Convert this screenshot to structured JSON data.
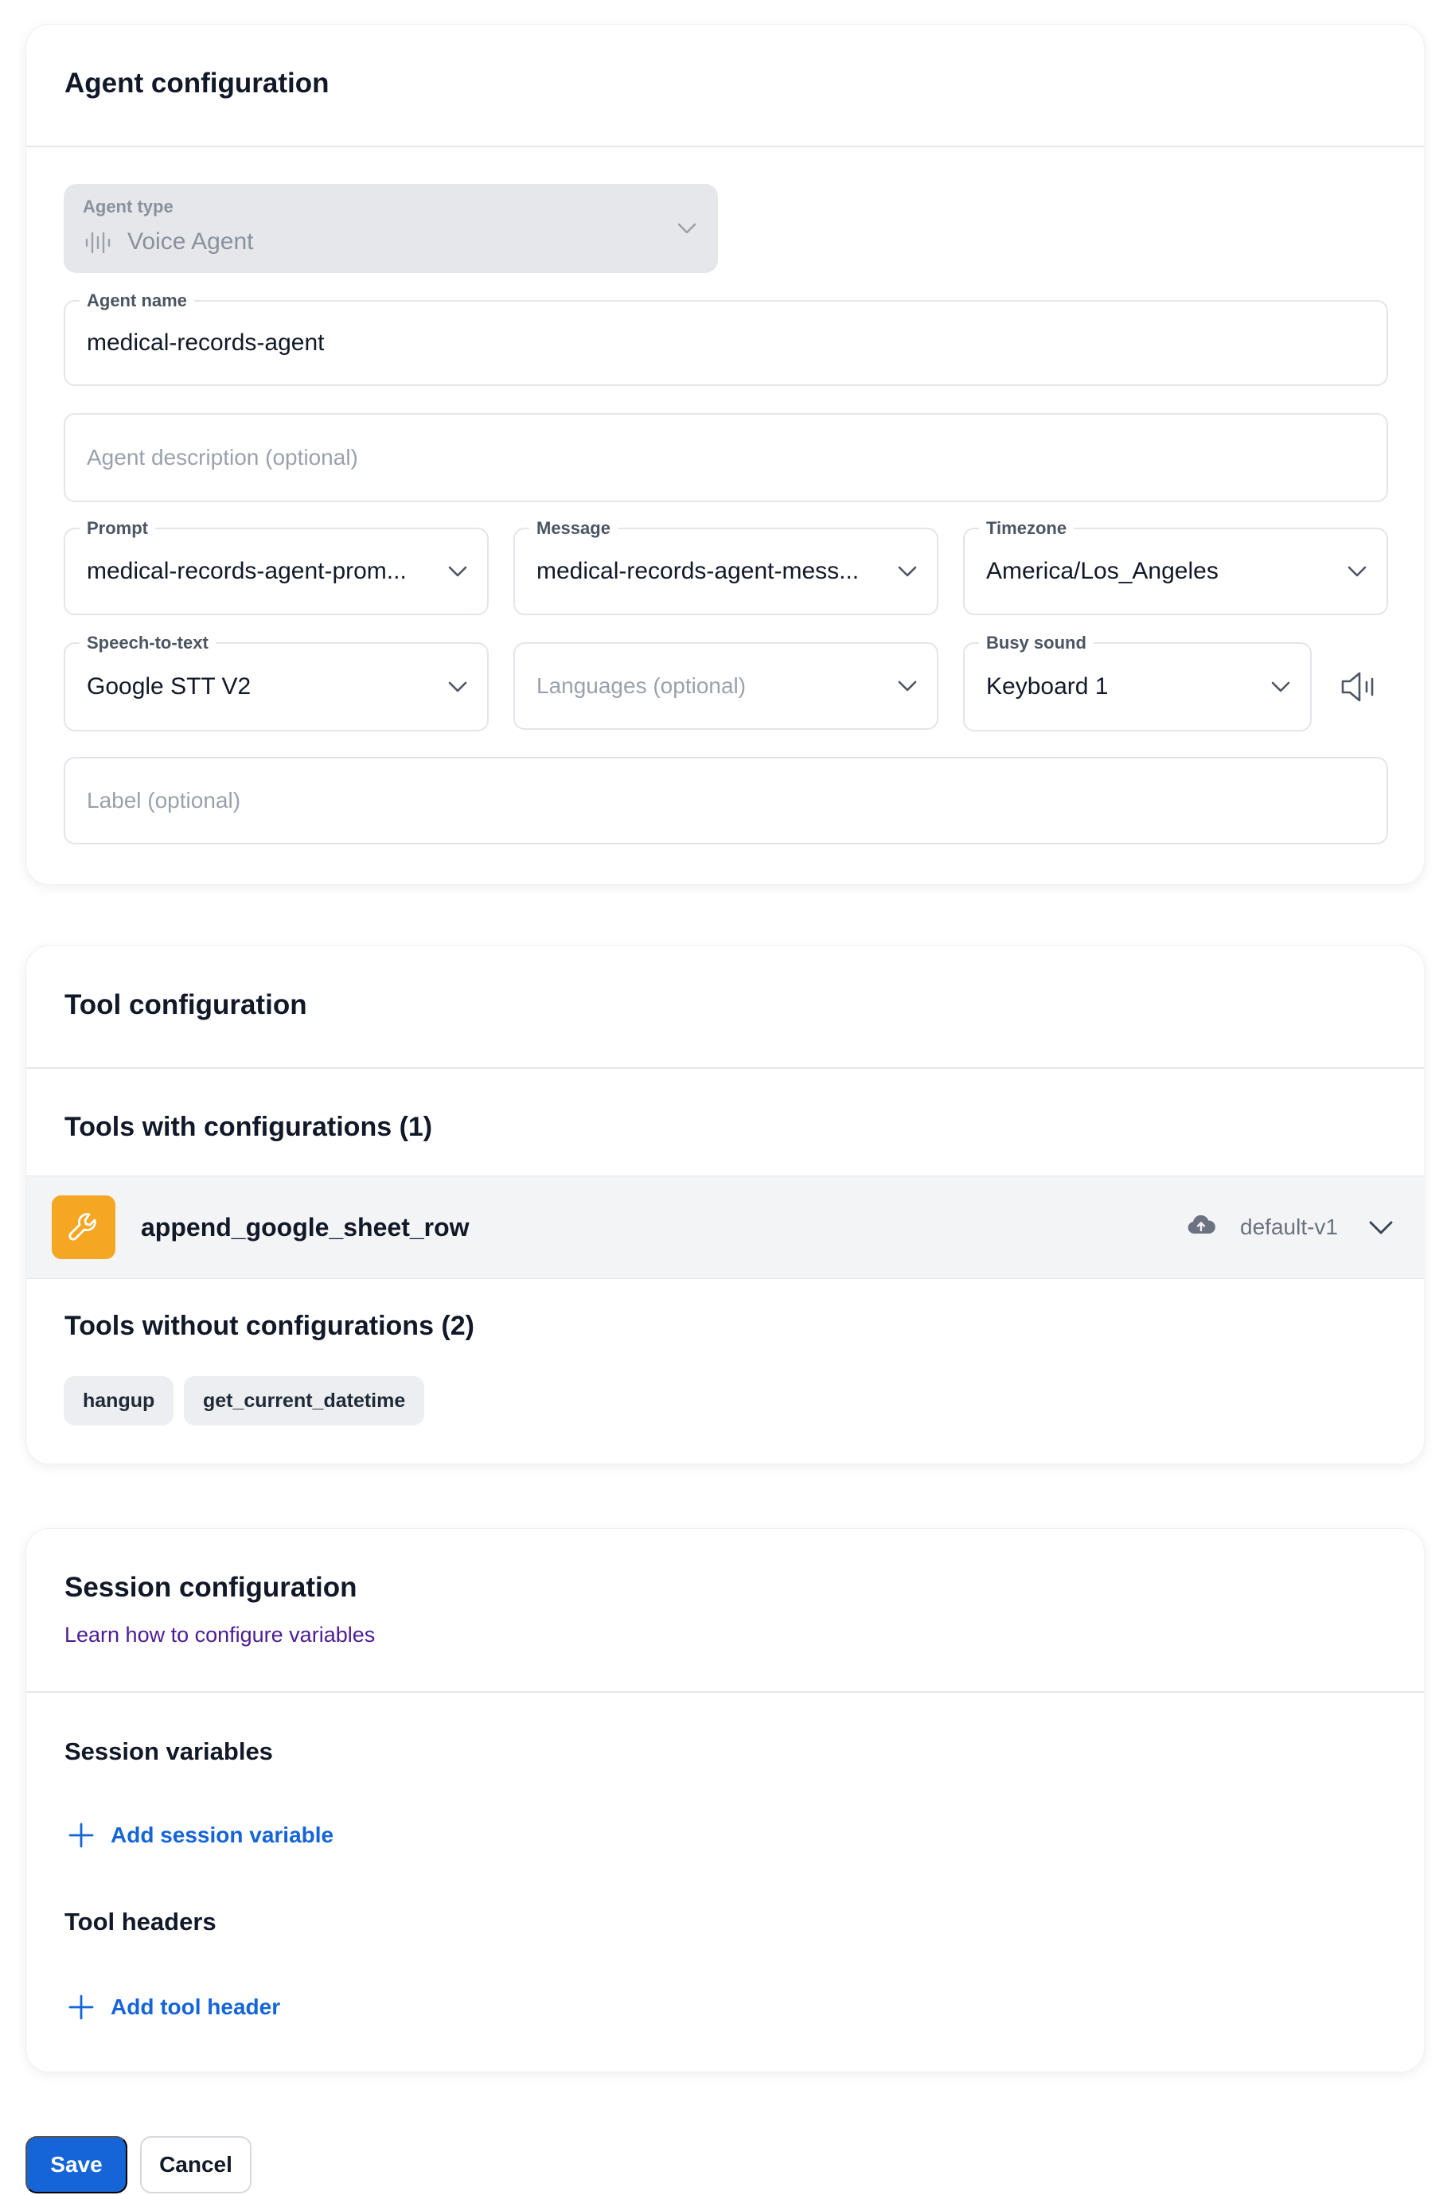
{
  "agent_config": {
    "title": "Agent configuration",
    "agent_type": {
      "label": "Agent type",
      "value": "Voice Agent"
    },
    "agent_name": {
      "label": "Agent name",
      "value": "medical-records-agent"
    },
    "agent_description": {
      "placeholder": "Agent description (optional)"
    },
    "prompt": {
      "label": "Prompt",
      "value": "medical-records-agent-prom..."
    },
    "message": {
      "label": "Message",
      "value": "medical-records-agent-mess..."
    },
    "timezone": {
      "label": "Timezone",
      "value": "America/Los_Angeles"
    },
    "speech_to_text": {
      "label": "Speech-to-text",
      "value": "Google STT V2"
    },
    "languages": {
      "placeholder": "Languages (optional)"
    },
    "busy_sound": {
      "label": "Busy sound",
      "value": "Keyboard 1"
    },
    "label_field": {
      "placeholder": "Label (optional)"
    }
  },
  "tool_config": {
    "title": "Tool configuration",
    "with_title": "Tools with configurations (1)",
    "tools_with": [
      {
        "name": "append_google_sheet_row",
        "version": "default-v1"
      }
    ],
    "without_title": "Tools without configurations (2)",
    "tools_without": [
      "hangup",
      "get_current_datetime"
    ]
  },
  "session_config": {
    "title": "Session configuration",
    "link": "Learn how to configure variables",
    "variables_title": "Session variables",
    "add_variable": "Add session variable",
    "headers_title": "Tool headers",
    "add_header": "Add tool header"
  },
  "actions": {
    "save": "Save",
    "cancel": "Cancel"
  },
  "colors": {
    "accent": "#1565d8",
    "tool_icon": "#f5a623",
    "link": "#4c1d95"
  }
}
